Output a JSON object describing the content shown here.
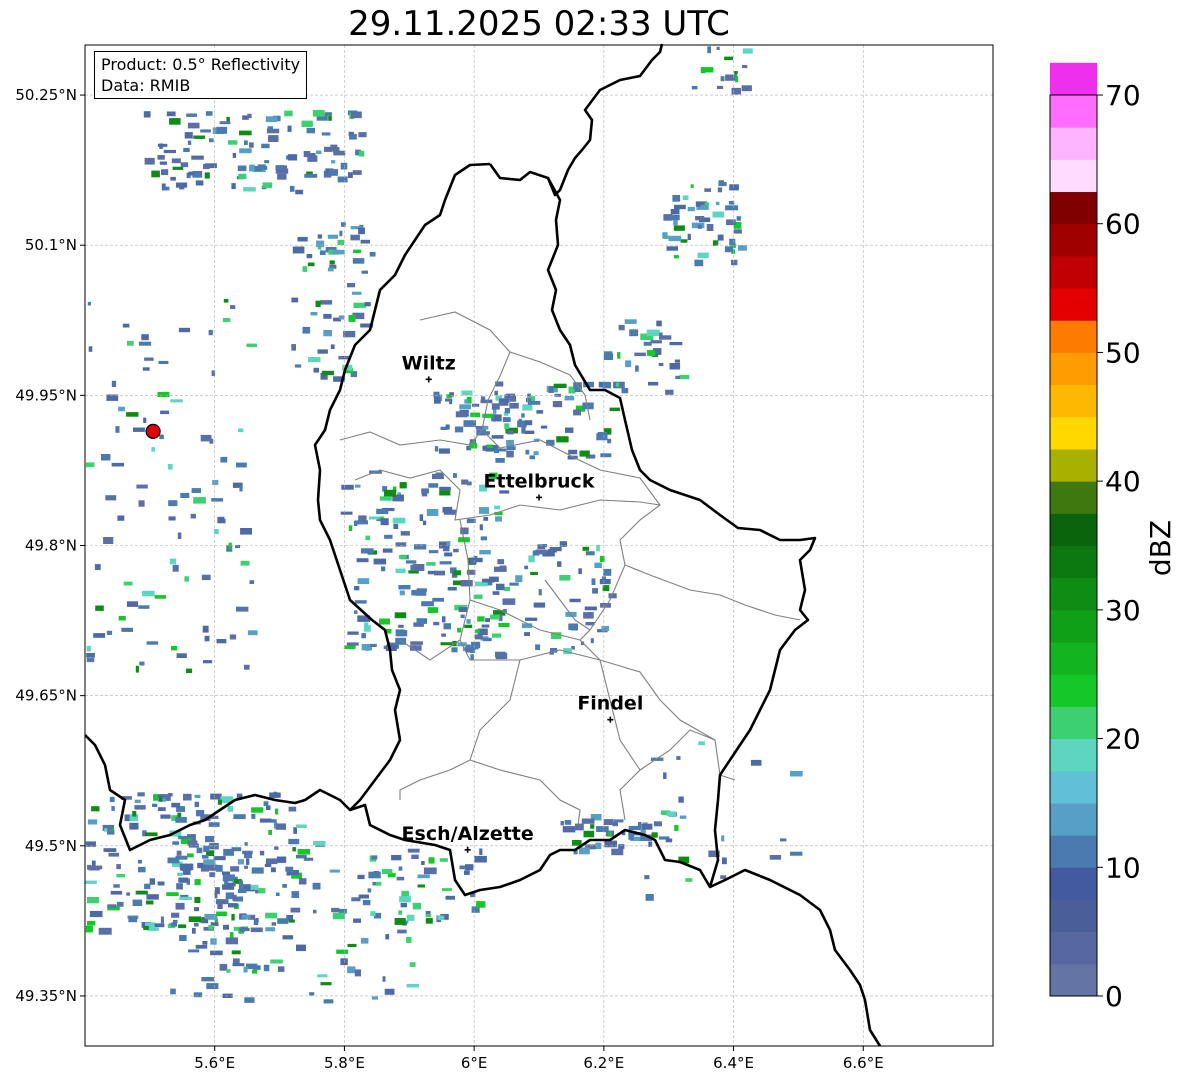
{
  "title": "29.11.2025 02:33 UTC",
  "info": {
    "product": "Product: 0.5° Reflectivity",
    "data": "Data: RMIB"
  },
  "map": {
    "lon_range": [
      5.4,
      6.8
    ],
    "lat_range": [
      49.3,
      50.3
    ],
    "lon_ticks": [
      5.6,
      5.8,
      6.0,
      6.2,
      6.4,
      6.6
    ],
    "lon_tick_labels": [
      "5.6°E",
      "5.8°E",
      "6°E",
      "6.2°E",
      "6.4°E",
      "6.6°E"
    ],
    "lat_ticks": [
      49.35,
      49.5,
      49.65,
      49.8,
      49.95,
      50.1,
      50.25
    ],
    "lat_tick_labels": [
      "49.35°N",
      "49.5°N",
      "49.65°N",
      "49.8°N",
      "49.95°N",
      "50.1°N",
      "50.25°N"
    ],
    "grid": true,
    "radar_site": {
      "lon": 5.505,
      "lat": 49.914
    },
    "cities": [
      {
        "name": "Wiltz",
        "lon": 5.93,
        "lat": 49.966
      },
      {
        "name": "Ettelbruck",
        "lon": 6.1,
        "lat": 49.848
      },
      {
        "name": "Findel",
        "lon": 6.21,
        "lat": 49.626
      },
      {
        "name": "Esch/Alzette",
        "lon": 5.99,
        "lat": 49.496
      }
    ]
  },
  "colorbar": {
    "label": "dBZ",
    "range": [
      0,
      70
    ],
    "ticks": [
      0,
      10,
      20,
      30,
      40,
      50,
      60,
      70
    ],
    "step": 2.5,
    "colors": [
      "#6474a4",
      "#56689f",
      "#4a5e9a",
      "#435aa0",
      "#4a7ab0",
      "#56a0c8",
      "#60c0d8",
      "#5cd6c0",
      "#3cd070",
      "#14c828",
      "#12b420",
      "#10a018",
      "#0e8c14",
      "#0c7810",
      "#0a640c",
      "#407810",
      "#a8b000",
      "#ffd800",
      "#ffb800",
      "#ff9c00",
      "#ff7c00",
      "#e40000",
      "#c00000",
      "#a00000",
      "#800000",
      "#ffdcff",
      "#ffb4ff",
      "#ff6cff",
      "#ee30ee"
    ]
  }
}
